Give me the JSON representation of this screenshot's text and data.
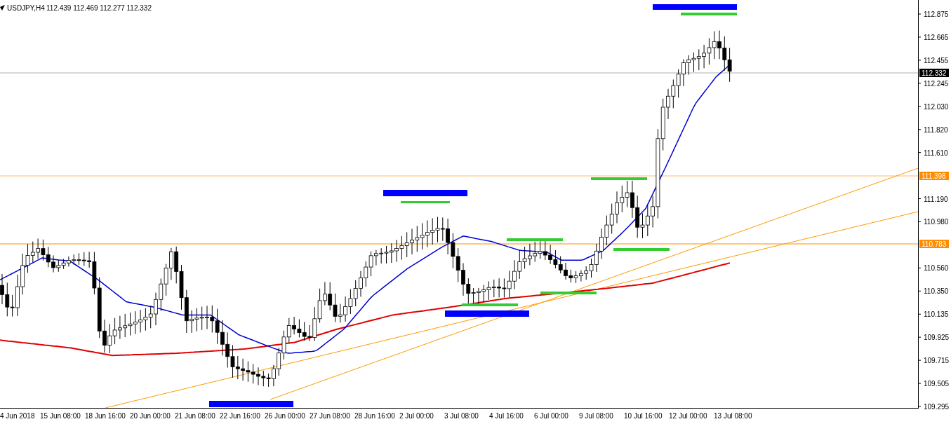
{
  "chart_header": {
    "symbol": "USDJPY,H4",
    "quote": "112.439 112.469 112.277 112.332"
  },
  "price_axis": {
    "labels": [
      "112.875",
      "112.665",
      "112.455",
      "112.245",
      "112.030",
      "111.820",
      "111.610",
      "111.190",
      "110.980",
      "110.560",
      "110.350",
      "110.135",
      "109.925",
      "109.715",
      "109.505",
      "109.295"
    ]
  },
  "price_tags": [
    {
      "label": "112.332",
      "kind": "current",
      "color": "#000000"
    },
    {
      "label": "111.398",
      "kind": "level",
      "color": "#ff8c00"
    },
    {
      "label": "110.783",
      "kind": "level",
      "color": "#ff8c00"
    }
  ],
  "time_axis": {
    "labels": [
      "4 Jun 2018",
      "15 Jun 08:00",
      "18 Jun 16:00",
      "20 Jun 00:00",
      "21 Jun 08:00",
      "22 Jun 16:00",
      "26 Jun 00:00",
      "27 Jun 08:00",
      "28 Jun 16:00",
      "2 Jul 00:00",
      "3 Jul 08:00",
      "4 Jul 16:00",
      "6 Jul 00:00",
      "9 Jul 08:00",
      "10 Jul 16:00",
      "12 Jul 00:00",
      "13 Jul 08:00"
    ]
  }
}
